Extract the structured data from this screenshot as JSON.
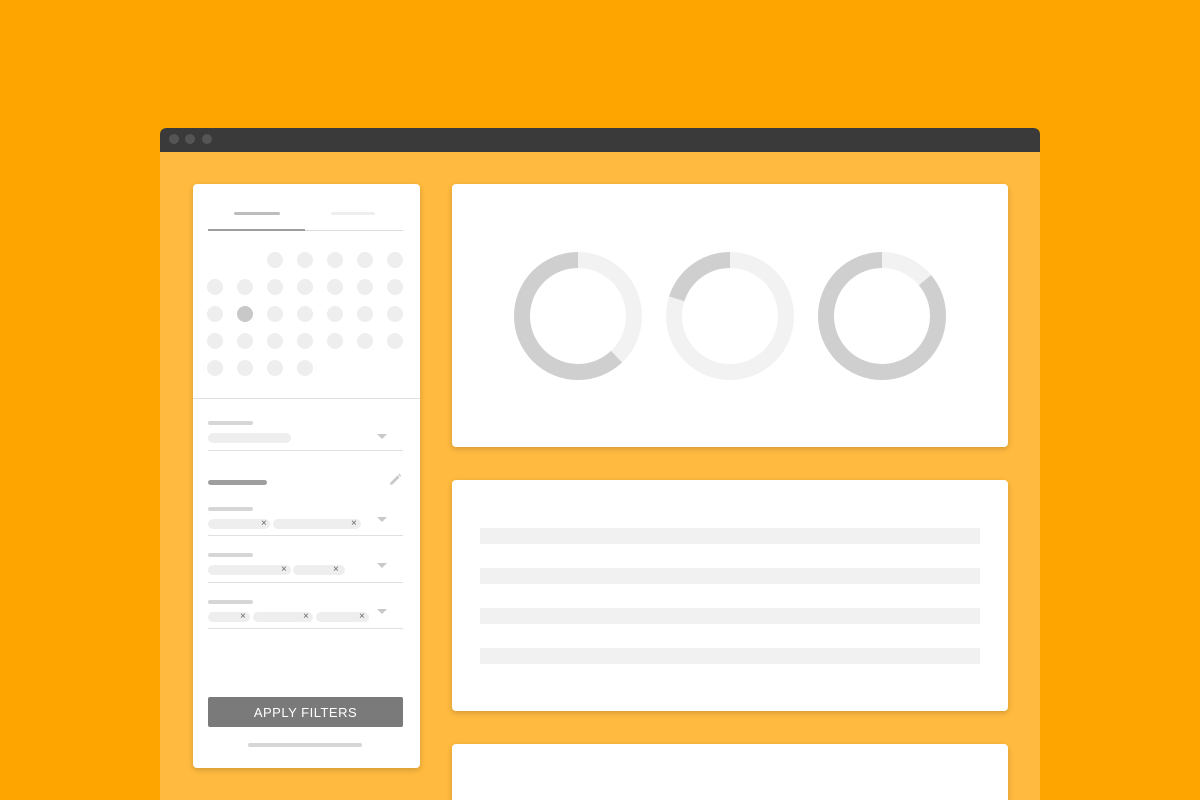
{
  "window": {
    "titlebar_buttons": [
      "close",
      "minimize",
      "maximize"
    ]
  },
  "filters": {
    "apply_label": "APPLY FILTERS",
    "selected_day_index": 13
  },
  "donuts": [
    {
      "name": "donut-1",
      "fraction": 0.62
    },
    {
      "name": "donut-2",
      "fraction": 0.2
    },
    {
      "name": "donut-3",
      "fraction": 0.86
    }
  ],
  "colors": {
    "background": "#FFA500",
    "window_bg": "#FFBA3F",
    "titlebar": "#3A3A3A",
    "donut_fill": "#CFCFCF",
    "donut_track": "#F2F2F2",
    "button": "#7A7A7A"
  }
}
